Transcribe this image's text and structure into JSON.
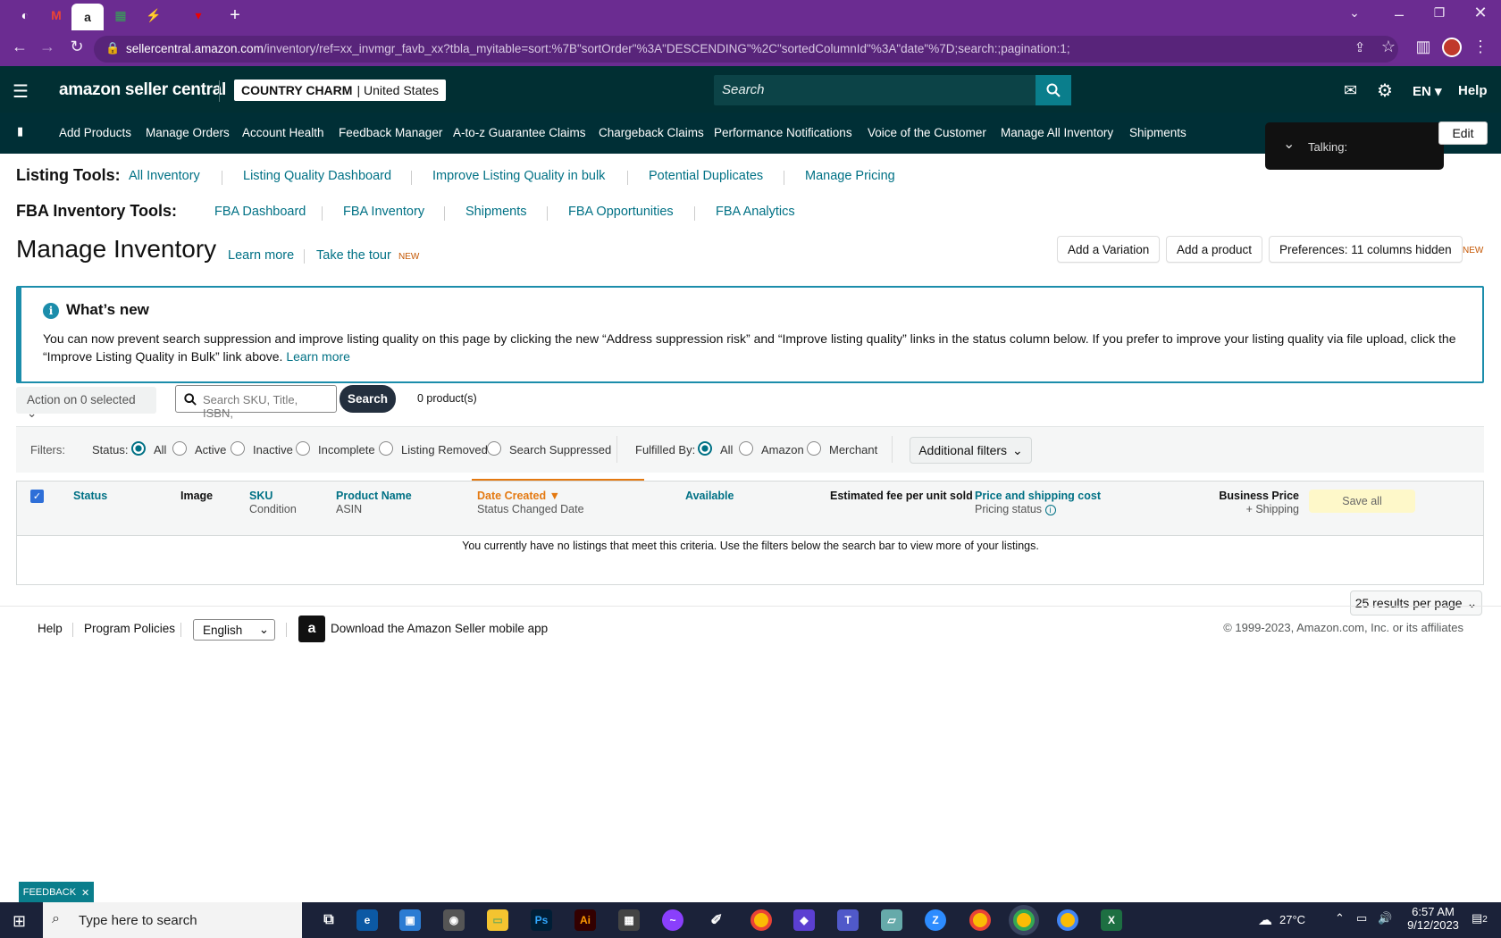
{
  "browser": {
    "url_host": "sellercentral.amazon.com",
    "url_path": "/inventory/ref=xx_invmgr_favb_xx?tbla_myitable=sort:%7B\"sortOrder\"%3A\"DESCENDING\"%2C\"sortedColumnId\"%3A\"date\"%7D;search:;pagination:1;"
  },
  "header": {
    "logo_a": "amazon",
    "logo_b": " seller central",
    "store": "COUNTRY CHARM",
    "market": "| United States",
    "search_placeholder": "Search",
    "lang": "EN",
    "help": "Help"
  },
  "subnav": [
    "Add Products",
    "Manage Orders",
    "Account Health",
    "Feedback Manager",
    "A-to-z Guarantee Claims",
    "Chargeback Claims",
    "Performance Notifications",
    "Voice of the Customer",
    "Manage All Inventory",
    "Shipments"
  ],
  "talking": "Talking:",
  "edit": "Edit",
  "listing_tools": {
    "label": "Listing Tools:",
    "links": [
      "All Inventory",
      "Listing Quality Dashboard",
      "Improve Listing Quality in bulk",
      "Potential Duplicates",
      "Manage Pricing"
    ]
  },
  "fba_tools": {
    "label": "FBA Inventory Tools:",
    "links": [
      "FBA Dashboard",
      "FBA Inventory",
      "Shipments",
      "FBA Opportunities",
      "FBA Analytics"
    ]
  },
  "page": {
    "title": "Manage Inventory",
    "learn_more": "Learn more",
    "tour": "Take the tour",
    "new_badge": "NEW",
    "add_variation": "Add a Variation",
    "add_product": "Add a product",
    "preferences": "Preferences: 11 columns hidden"
  },
  "news": {
    "title": "What’s new",
    "body": "You can now prevent search suppression and improve listing quality on this page by clicking the new “Address suppression risk” and “Improve listing quality” links in the status column below. If you prefer to improve your listing quality via file upload, click the “Improve Listing Quality in Bulk” link above.",
    "link": "Learn more"
  },
  "search": {
    "action": "Action on 0 selected",
    "placeholder": "Search SKU, Title, ISBN,",
    "button": "Search",
    "count": "0 product(s)"
  },
  "filters": {
    "label": "Filters:",
    "status_label": "Status:",
    "status": [
      "All",
      "Active",
      "Inactive",
      "Incomplete",
      "Listing Removed",
      "Search Suppressed"
    ],
    "fulfilled_label": "Fulfilled By:",
    "fulfilled": [
      "All",
      "Amazon",
      "Merchant"
    ],
    "additional": "Additional filters"
  },
  "table": {
    "status": "Status",
    "image": "Image",
    "sku": "SKU",
    "condition": "Condition",
    "product": "Product Name",
    "asin": "ASIN",
    "date": "Date Created",
    "status_date": "Status Changed Date",
    "available": "Available",
    "fee": "Estimated fee per unit sold",
    "price": "Price and shipping cost",
    "pricing_status": "Pricing status",
    "business": "Business Price",
    "shipping": "+ Shipping",
    "save_all": "Save all",
    "empty": "You currently have no listings that meet this criteria. Use the filters below the search bar to view more of your listings.",
    "per_page": "25 results per page"
  },
  "footer": {
    "help": "Help",
    "policies": "Program Policies",
    "language": "English",
    "app": "Download the Amazon Seller mobile app",
    "copyright": "© 1999-2023, Amazon.com, Inc. or its affiliates"
  },
  "feedback": "FEEDBACK",
  "taskbar": {
    "search": "Type here to search",
    "temp": "27°C",
    "time": "6:57 AM",
    "date": "9/12/2023",
    "notif": "2"
  }
}
